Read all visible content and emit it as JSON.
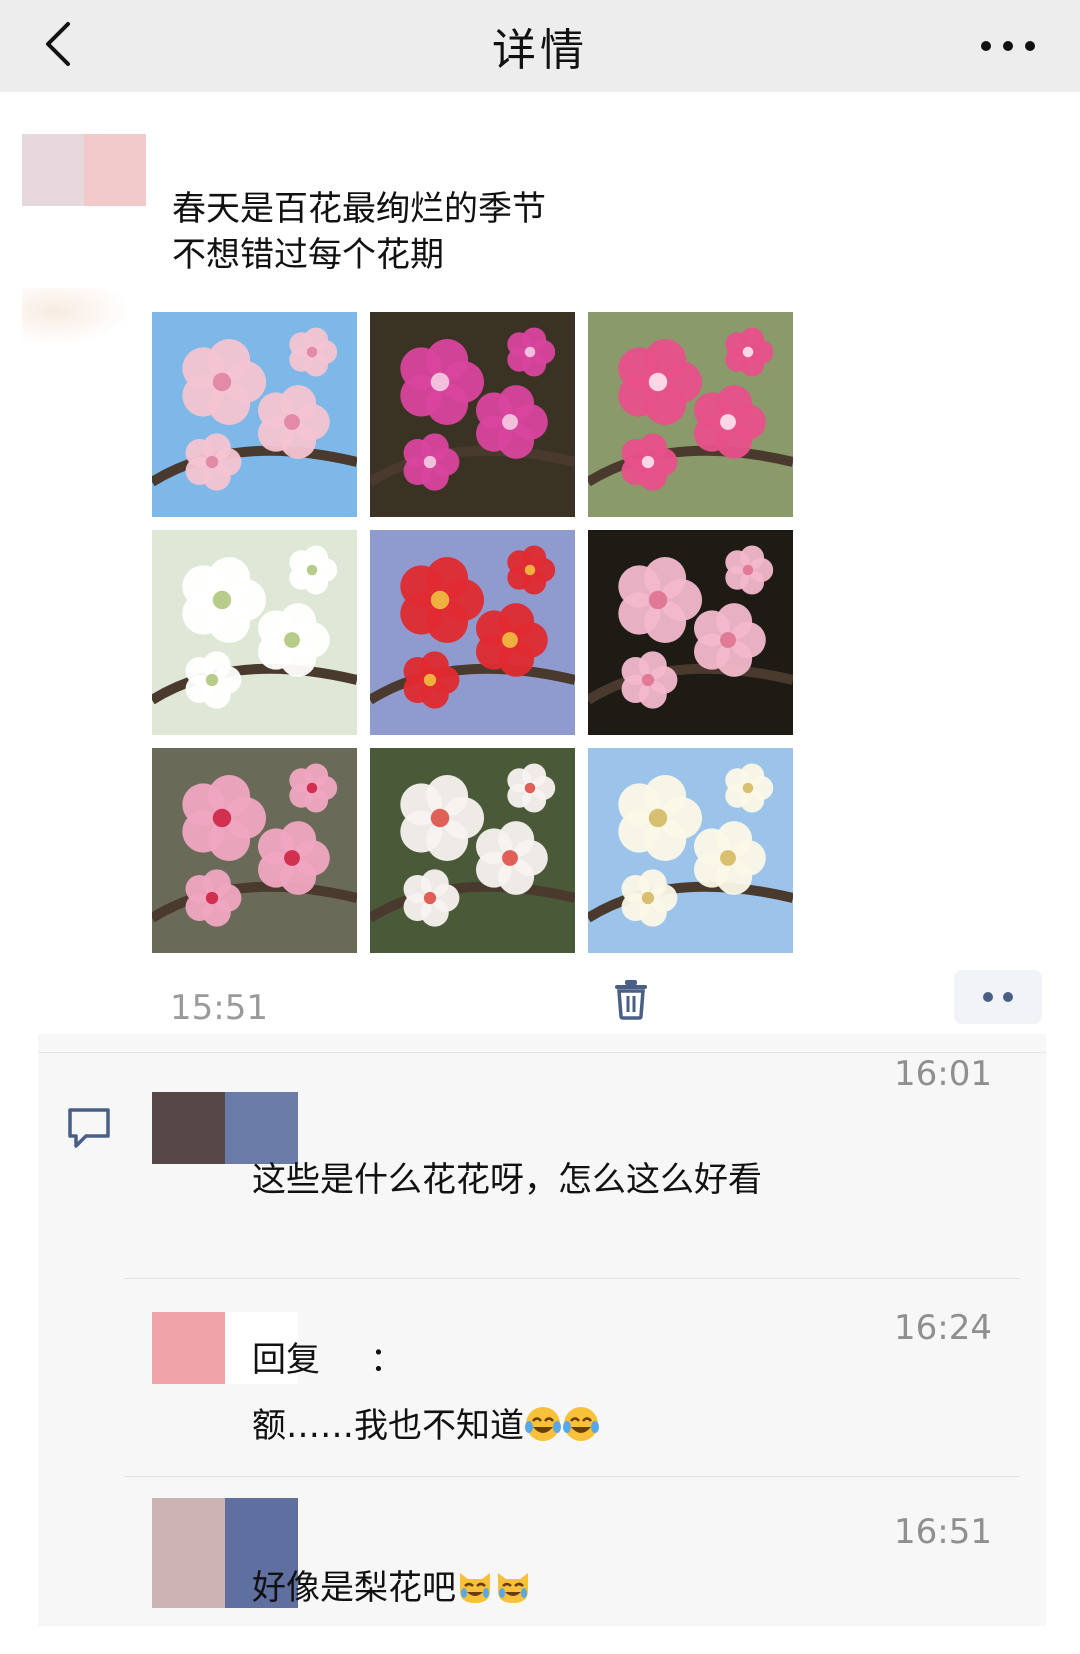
{
  "navbar": {
    "title": "详情",
    "back_icon": "chevron-left-icon",
    "more_icon": "more-horizontal-icon",
    "background": "#ededed"
  },
  "post": {
    "text_lines": [
      "春天是百花最绚烂的季节",
      "不想错过每个花期"
    ],
    "photos": [
      {
        "name": "pink-cherry-blossom",
        "bg": "#7db8e8",
        "petal": "#f4c4d2",
        "center": "#e38aa8"
      },
      {
        "name": "magenta-plum-blossom",
        "bg": "#3a3324",
        "petal": "#d9449e",
        "center": "#f2c0dc"
      },
      {
        "name": "pink-plum-blossom",
        "bg": "#8a9a6a",
        "petal": "#e8508a",
        "center": "#ffd6e6"
      },
      {
        "name": "white-pear-blossom",
        "bg": "#dfe8d6",
        "petal": "#ffffff",
        "center": "#b7cc8a"
      },
      {
        "name": "red-quince-blossom",
        "bg": "#8f9bcf",
        "petal": "#e02a30",
        "center": "#f0b040"
      },
      {
        "name": "light-pink-plum",
        "bg": "#1e1a14",
        "petal": "#f3b8cc",
        "center": "#e07a96"
      },
      {
        "name": "peach-blossom",
        "bg": "#6a6a58",
        "petal": "#f0a6c0",
        "center": "#d23050"
      },
      {
        "name": "white-magnolia",
        "bg": "#4a5a38",
        "petal": "#f7f3f0",
        "center": "#e06058"
      },
      {
        "name": "white-pear-cluster",
        "bg": "#9cc4ea",
        "petal": "#fbf8e8",
        "center": "#d8c070"
      }
    ],
    "time": "15:51",
    "delete_icon": "trash-icon",
    "more_icon": "more-dots-icon"
  },
  "comments": {
    "icon": "comment-bubble-icon",
    "items": [
      {
        "time": "16:01",
        "text": "这些是什么花花呀，怎么这么好看",
        "avatar_colors": [
          "#574847",
          "#6b7ba8"
        ]
      },
      {
        "time": "16:24",
        "reply_label": "回复",
        "reply_sep": "：",
        "text": "额……我也不知道",
        "emoji": "tears-of-joy-emoji",
        "avatar_colors": [
          "#f0a3a8",
          "#ffffff"
        ]
      },
      {
        "time": "16:51",
        "text": "好像是梨花吧",
        "emoji": "crying-cat-emoji",
        "avatar_colors": [
          "#cbb3b3",
          "#5f6fa0"
        ]
      }
    ]
  }
}
